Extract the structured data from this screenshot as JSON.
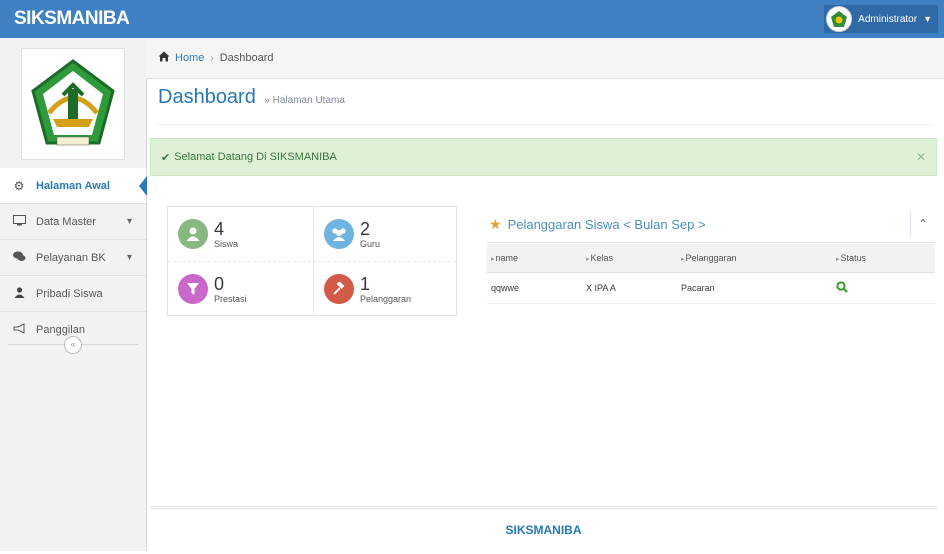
{
  "app": {
    "brand": "SIKSMANIBA"
  },
  "user": {
    "name": "Administrator",
    "avatar_icon": "school-logo-icon"
  },
  "sidebar": {
    "items": [
      {
        "label": "Halaman Awal",
        "icon": "dashboard-icon",
        "active": true
      },
      {
        "label": "Data Master",
        "icon": "desktop-icon",
        "has_submenu": true
      },
      {
        "label": "Pelayanan BK",
        "icon": "comments-icon",
        "has_submenu": true
      },
      {
        "label": "Pribadi Siswa",
        "icon": "user-icon"
      },
      {
        "label": "Panggilan",
        "icon": "bullhorn-icon"
      }
    ]
  },
  "breadcrumb": {
    "home": "Home",
    "current": "Dashboard"
  },
  "page": {
    "title": "Dashboard",
    "subtitle": "Halaman Utama"
  },
  "alert": {
    "text": "Selamat Datang Di SIKSMANIBA"
  },
  "stats": [
    {
      "value": "4",
      "label": "Siswa",
      "color": "#87b87f",
      "icon": "user-icon"
    },
    {
      "value": "2",
      "label": "Guru",
      "color": "#6fb3e0",
      "icon": "users-icon"
    },
    {
      "value": "0",
      "label": "Prestasi",
      "color": "#c868c8",
      "icon": "filter-icon"
    },
    {
      "value": "1",
      "label": "Pelanggaran",
      "color": "#d15b47",
      "icon": "gavel-icon"
    }
  ],
  "violations": {
    "title": "Pelanggaran Siswa < Bulan Sep >",
    "columns": [
      "name",
      "Kelas",
      "Pelanggaran",
      "Status"
    ],
    "rows": [
      {
        "name": "qqwwe",
        "kelas": "X IPA A",
        "pelanggaran": "Pacaran",
        "status_icon": "search-icon"
      }
    ]
  },
  "footer": {
    "text": "SIKSMANIBA"
  },
  "colors": {
    "navbar": "#3f80c2",
    "accent": "#2679b5",
    "success_bg": "#dff0d8"
  }
}
